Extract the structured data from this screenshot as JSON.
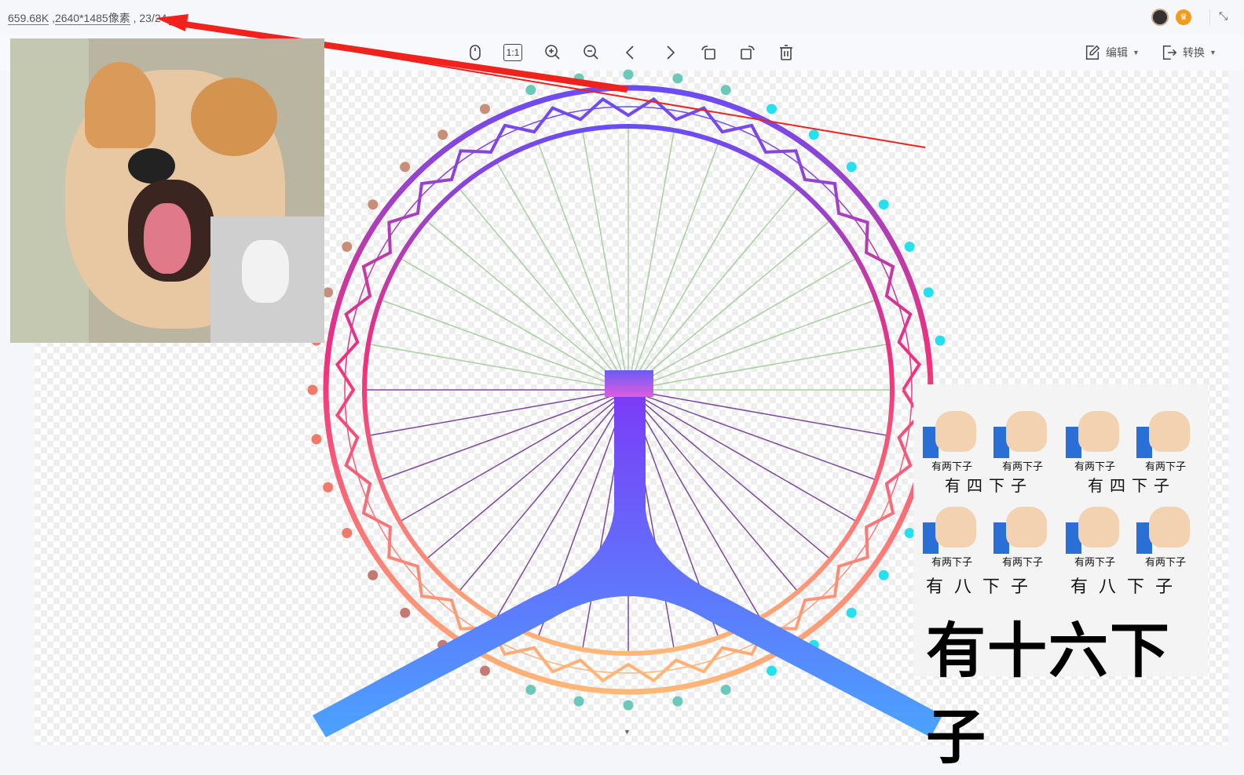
{
  "info": {
    "file_size": "659.68K",
    "dimensions": "2640*1485像素",
    "index": "23/24"
  },
  "toolbar": {
    "items": [
      "mouse",
      "actual-size",
      "zoom-in",
      "zoom-out",
      "previous",
      "next",
      "rotate-left",
      "rotate-right",
      "delete"
    ],
    "actual_size_label": "1:1",
    "edit_label": "编辑",
    "convert_label": "转换"
  },
  "colors": {
    "arrow": "#f0221e",
    "ring_top": "#6a4cf5",
    "ring_mid": "#f0307a",
    "ring_bottom": "#ffb877"
  },
  "meme": {
    "thumb_label": "有两下子",
    "caption_four": "有四下子",
    "caption_eight": "有八下子",
    "big_text": "有十六下子"
  }
}
